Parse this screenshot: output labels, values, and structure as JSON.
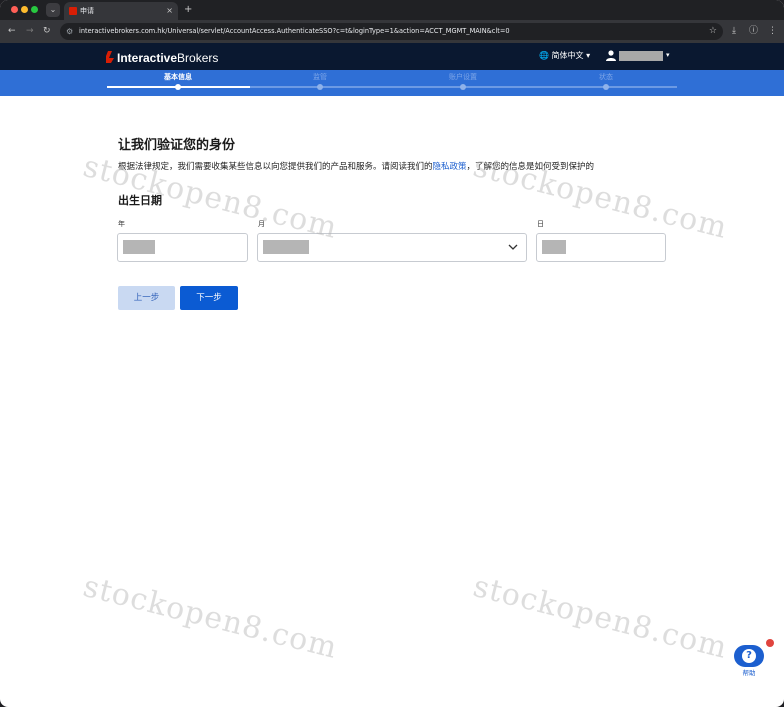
{
  "browser": {
    "tab_title": "申请",
    "tab_close": "×",
    "new_tab": "+",
    "url": "interactivebrokers.com.hk/Universal/servlet/AccountAccess.AuthenticateSSO?c=t&loginType=1&action=ACCT_MGMT_MAIN&clt=0"
  },
  "header": {
    "logo_bold": "Interactive",
    "logo_regular": "Brokers",
    "language": "简体中文",
    "language_caret": "▾",
    "user_caret": "▾"
  },
  "steps": [
    {
      "label": "基本信息",
      "active": true
    },
    {
      "label": "监管",
      "active": false
    },
    {
      "label": "账户设置",
      "active": false
    },
    {
      "label": "状态",
      "active": false
    }
  ],
  "main": {
    "title": "让我们验证您的身份",
    "desc_before": "根据法律规定，我们需要收集某些信息以向您提供我们的产品和服务。请阅读我们的",
    "desc_link": "隐私政策",
    "desc_after": "，了解您的信息是如何受到保护的",
    "dob_title": "出生日期",
    "year_label": "年",
    "month_label": "月",
    "day_label": "日"
  },
  "buttons": {
    "prev": "上一步",
    "next": "下一步"
  },
  "help": {
    "label": "帮助",
    "icon": "?"
  },
  "watermark": "stockopen8.com",
  "colors": {
    "header_bg": "#0a1830",
    "steps_bg": "#2f6fd6",
    "primary": "#0b5bd3",
    "link": "#1c5fcf",
    "logo_red": "#d81e05"
  }
}
